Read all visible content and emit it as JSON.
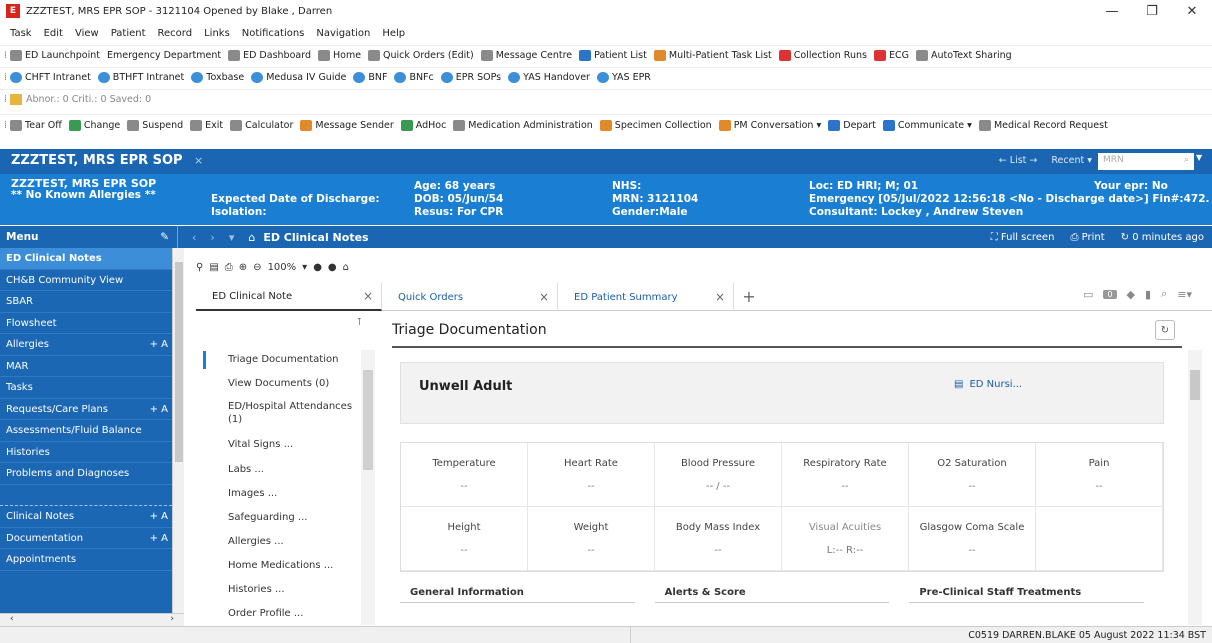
{
  "window": {
    "title": "ZZZTEST, MRS EPR SOP - 3121104 Opened by Blake , Darren",
    "app_icon": "E"
  },
  "menubar": [
    "Task",
    "Edit",
    "View",
    "Patient",
    "Record",
    "Links",
    "Notifications",
    "Navigation",
    "Help"
  ],
  "toolbar1": [
    "ED Launchpoint",
    "Emergency Department",
    "ED Dashboard",
    "Home",
    "Quick Orders (Edit)",
    "Message Centre",
    "Patient List",
    "Multi-Patient Task List",
    "Collection Runs",
    "ECG",
    "AutoText Sharing"
  ],
  "toolbar2": [
    "CHFT Intranet",
    "BTHFT Intranet",
    "Toxbase",
    "Medusa IV Guide",
    "BNF",
    "BNFc",
    "EPR SOPs",
    "YAS Handover",
    "YAS EPR"
  ],
  "toolbar3": "Abnor.: 0  Criti.: 0  Saved: 0",
  "toolbar4": [
    "Tear Off",
    "Change",
    "Suspend",
    "Exit",
    "Calculator",
    "Message Sender",
    "AdHoc",
    "Medication Administration",
    "Specimen Collection",
    "PM Conversation ▾",
    "Depart",
    "Communicate ▾",
    "Medical Record Request"
  ],
  "patient_tab": {
    "name": "ZZZTEST, MRS EPR SOP",
    "close": "×",
    "list": "← List →",
    "recent": "Recent ▾",
    "mrn_placeholder": "MRN"
  },
  "banner": {
    "name": "ZZZTEST, MRS EPR SOP",
    "allergies": "** No Known Allergies **",
    "discharge": "Expected Date of Discharge:",
    "isolation": "Isolation:",
    "age": "Age: 68 years",
    "dob": "DOB: 05/Jun/54",
    "resus": "Resus: For CPR",
    "nhs": "NHS:",
    "mrn": "MRN: 3121104",
    "gender": "Gender:Male",
    "loc": "Loc: ED HRI; M; 01",
    "encounter": "Emergency [05/Jul/2022 12:56:18  <No - Discharge date>] Fin#:472...",
    "consultant": "Consultant: Lockey , Andrew Steven",
    "epr": "Your epr: No"
  },
  "nav": {
    "menu": "Menu",
    "title": "ED Clinical Notes",
    "fullscreen": "Full screen",
    "print": "Print",
    "updated": "0 minutes ago"
  },
  "sidebar": [
    "ED Clinical Notes",
    "CH&B Community View",
    "SBAR",
    "Flowsheet",
    "Allergies",
    "MAR",
    "Tasks",
    "Requests/Care Plans",
    "Assessments/Fluid Balance",
    "Histories",
    "Problems and Diagnoses",
    "",
    "Clinical Notes",
    "Documentation",
    "Appointments"
  ],
  "sidebar_add": "+ A",
  "docbar": {
    "zoom": "100%"
  },
  "tabs": [
    {
      "label": "ED Clinical Note"
    },
    {
      "label": "Quick Orders"
    },
    {
      "label": "ED Patient Summary"
    }
  ],
  "toc": [
    "Triage Documentation",
    "View Documents (0)",
    "ED/Hospital Attendances (1)",
    "Vital Signs ...",
    "Labs ...",
    "Images ...",
    "Safeguarding ...",
    "Allergies ...",
    "Home Medications ...",
    "Histories ...",
    "Order Profile ..."
  ],
  "main": {
    "heading": "Triage Documentation",
    "card_title": "Unwell Adult",
    "card_link": "ED Nursi..."
  },
  "vitals": [
    {
      "label": "Temperature",
      "value": "--"
    },
    {
      "label": "Heart Rate",
      "value": "--"
    },
    {
      "label": "Blood Pressure",
      "value": "-- / --"
    },
    {
      "label": "Respiratory Rate",
      "value": "--"
    },
    {
      "label": "O2 Saturation",
      "value": "--"
    },
    {
      "label": "Pain",
      "value": "--"
    },
    {
      "label": "Height",
      "value": "--"
    },
    {
      "label": "Weight",
      "value": "--"
    },
    {
      "label": "Body Mass Index",
      "value": "--"
    },
    {
      "label": "Visual Acuities",
      "value": "L:--   R:--"
    },
    {
      "label": "Glasgow Coma Scale",
      "value": "--"
    },
    {
      "label": "",
      "value": ""
    }
  ],
  "sections": [
    "General Information",
    "Alerts & Score",
    "Pre-Clinical Staff Treatments"
  ],
  "status": "C0519  DARREN.BLAKE  05 August 2022  11:34 BST"
}
